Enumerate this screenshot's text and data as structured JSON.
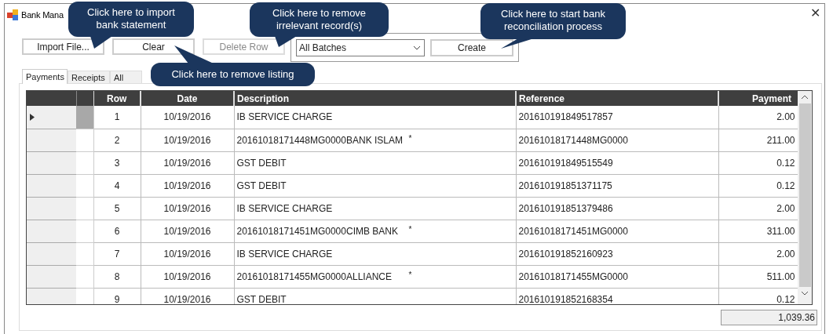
{
  "window": {
    "title": "Bank Mana",
    "close": "✕"
  },
  "toolbar": {
    "buttons": [
      {
        "label": "Import File...",
        "disabled": false
      },
      {
        "label": "Clear",
        "disabled": false
      },
      {
        "label": "Delete Row",
        "disabled": true
      }
    ],
    "batch_select": {
      "value": "All Batches"
    },
    "create_button": "Create"
  },
  "tabs": [
    {
      "label": "Payments",
      "selected": true
    },
    {
      "label": "Receipts",
      "selected": false
    },
    {
      "label": "All",
      "selected": false
    }
  ],
  "table": {
    "columns": [
      "Row",
      "Date",
      "Description",
      "Reference",
      "Payment"
    ],
    "rows": [
      {
        "selected": true,
        "row": "1",
        "date": "10/19/2016",
        "description": "IB SERVICE CHARGE",
        "reference": "201610191849517857",
        "payment": "2.00"
      },
      {
        "selected": false,
        "row": "2",
        "date": "10/19/2016",
        "description": "20161018171448MG0000BANK ISLAM",
        "flag": "*",
        "reference": "20161018171448MG0000",
        "payment": "211.00"
      },
      {
        "selected": false,
        "row": "3",
        "date": "10/19/2016",
        "description": "GST DEBIT",
        "reference": "201610191849515549",
        "payment": "0.12"
      },
      {
        "selected": false,
        "row": "4",
        "date": "10/19/2016",
        "description": "GST DEBIT",
        "reference": "201610191851371175",
        "payment": "0.12"
      },
      {
        "selected": false,
        "row": "5",
        "date": "10/19/2016",
        "description": "IB SERVICE CHARGE",
        "reference": "201610191851379486",
        "payment": "2.00"
      },
      {
        "selected": false,
        "row": "6",
        "date": "10/19/2016",
        "description": "20161018171451MG0000CIMB BANK",
        "flag": "*",
        "reference": "20161018171451MG0000",
        "payment": "311.00"
      },
      {
        "selected": false,
        "row": "7",
        "date": "10/19/2016",
        "description": "IB SERVICE CHARGE",
        "reference": "201610191852160923",
        "payment": "2.00"
      },
      {
        "selected": false,
        "row": "8",
        "date": "10/19/2016",
        "description": "20161018171455MG0000ALLIANCE",
        "flag": "*",
        "reference": "20161018171455MG0000",
        "payment": "511.00"
      },
      {
        "selected": false,
        "row": "9",
        "date": "10/19/2016",
        "description": "GST DEBIT",
        "reference": "201610191852168354",
        "payment": "0.12"
      }
    ],
    "total": "1,039.36"
  },
  "callouts": [
    {
      "text": "Click here to import bank statement"
    },
    {
      "text": "Click here to remove irrelevant record(s)"
    },
    {
      "text": "Click here to start bank reconciliation process"
    },
    {
      "text": "Click here to remove listing"
    }
  ]
}
